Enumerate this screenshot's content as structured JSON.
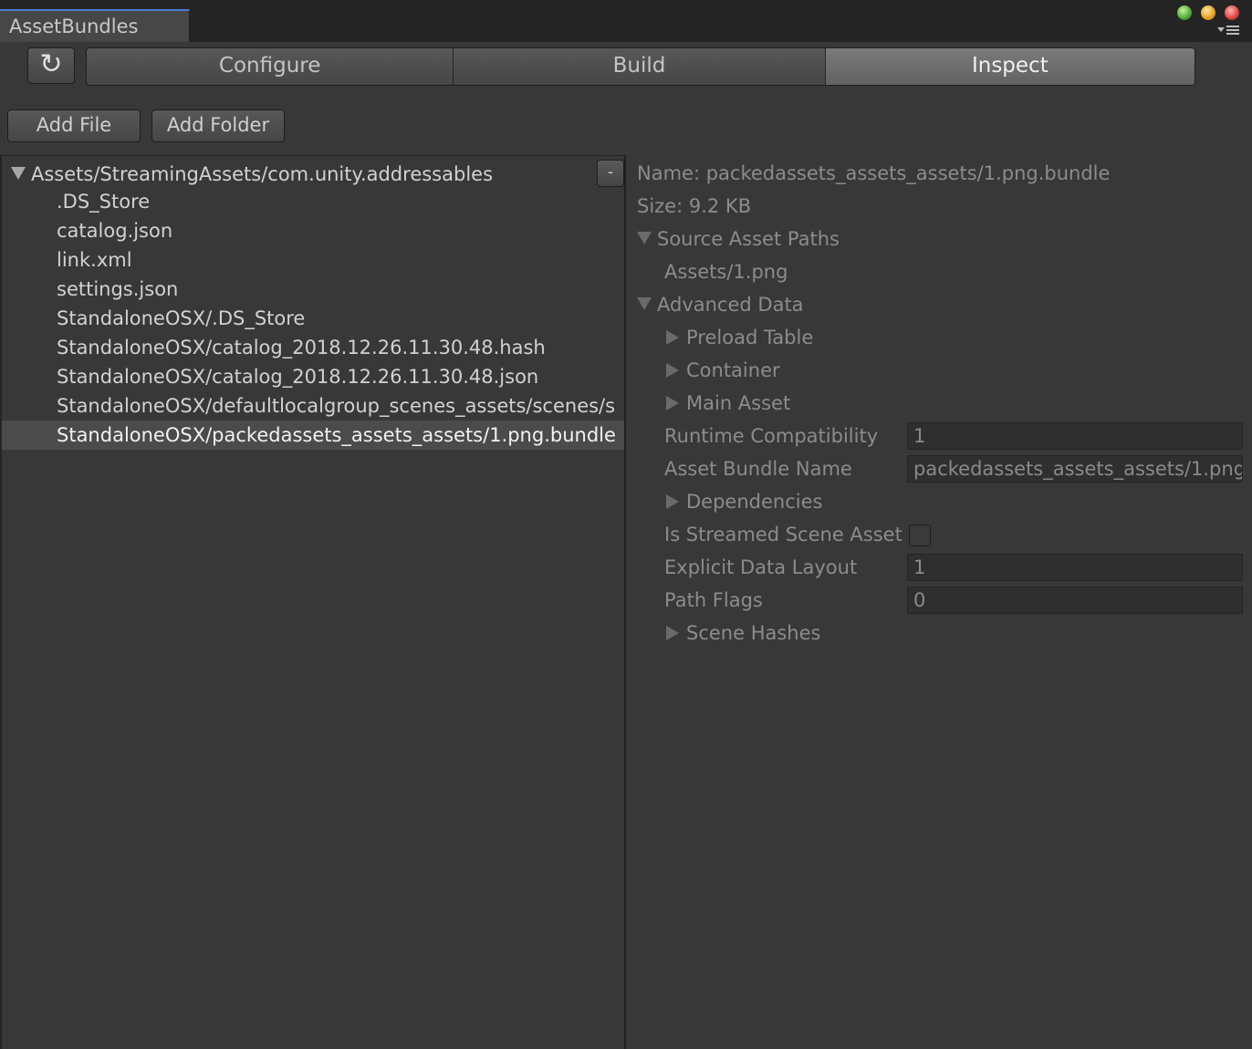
{
  "window": {
    "tab_title": "AssetBundles"
  },
  "toolbar": {
    "refresh_icon": "↻",
    "tabs": [
      "Configure",
      "Build",
      "Inspect"
    ],
    "selected_tab": "Inspect",
    "add_file_label": "Add File",
    "add_folder_label": "Add Folder"
  },
  "tree": {
    "root_label": "Assets/StreamingAssets/com.unity.addressables",
    "collapse_label": "-",
    "items": [
      ".DS_Store",
      "catalog.json",
      "link.xml",
      "settings.json",
      "StandaloneOSX/.DS_Store",
      "StandaloneOSX/catalog_2018.12.26.11.30.48.hash",
      "StandaloneOSX/catalog_2018.12.26.11.30.48.json",
      "StandaloneOSX/defaultlocalgroup_scenes_assets/scenes/s",
      "StandaloneOSX/packedassets_assets_assets/1.png.bundle"
    ],
    "selected_item": "StandaloneOSX/packedassets_assets_assets/1.png.bundle"
  },
  "inspector": {
    "name_line": "Name: packedassets_assets_assets/1.png.bundle",
    "size_line": "Size: 9.2 KB",
    "source_asset_paths_label": "Source Asset Paths",
    "source_asset_path": "Assets/1.png",
    "advanced_data_label": "Advanced Data",
    "preload_table_label": "Preload Table",
    "container_label": "Container",
    "main_asset_label": "Main Asset",
    "runtime_compat_label": "Runtime Compatibility",
    "runtime_compat_value": "1",
    "asset_bundle_name_label": "Asset Bundle Name",
    "asset_bundle_name_value": "packedassets_assets_assets/1.png",
    "dependencies_label": "Dependencies",
    "is_streamed_label": "Is Streamed Scene Asset",
    "is_streamed_checked": false,
    "explicit_layout_label": "Explicit Data Layout",
    "explicit_layout_value": "1",
    "path_flags_label": "Path Flags",
    "path_flags_value": "0",
    "scene_hashes_label": "Scene Hashes"
  },
  "colors": {
    "background": "#383838",
    "selection": "#4b4b4b",
    "tab_accent": "#4b7bd1"
  }
}
